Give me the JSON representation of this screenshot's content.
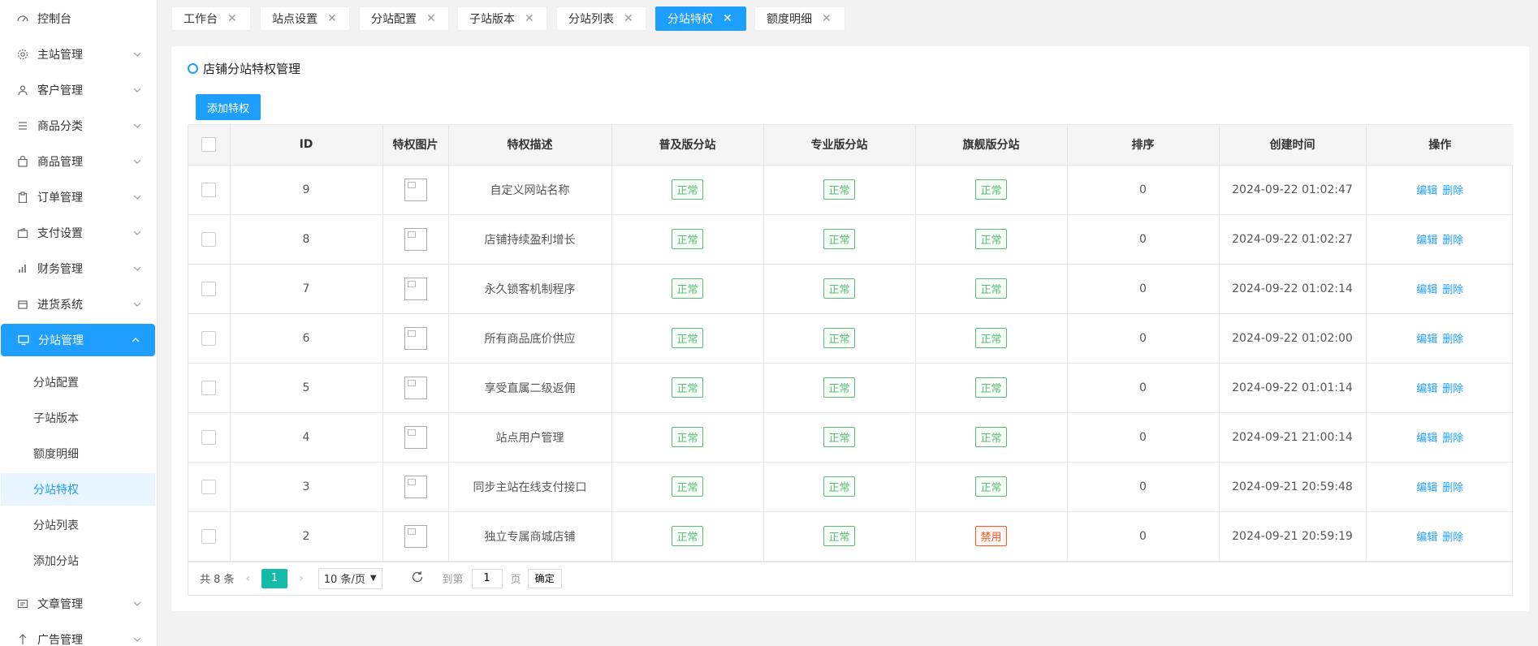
{
  "sidebar": {
    "items": [
      {
        "label": "控制台",
        "icon": "dashboard-icon",
        "has_arrow": false
      },
      {
        "label": "主站管理",
        "icon": "gear-icon",
        "has_arrow": true
      },
      {
        "label": "客户管理",
        "icon": "user-icon",
        "has_arrow": true
      },
      {
        "label": "商品分类",
        "icon": "list-icon",
        "has_arrow": true
      },
      {
        "label": "商品管理",
        "icon": "bag-icon",
        "has_arrow": true
      },
      {
        "label": "订单管理",
        "icon": "clipboard-icon",
        "has_arrow": true
      },
      {
        "label": "支付设置",
        "icon": "wallet-icon",
        "has_arrow": true
      },
      {
        "label": "财务管理",
        "icon": "bar-chart-icon",
        "has_arrow": true
      },
      {
        "label": "进货系统",
        "icon": "cart-icon",
        "has_arrow": true
      },
      {
        "label": "分站管理",
        "icon": "monitor-icon",
        "has_arrow": true,
        "active": true
      },
      {
        "label": "文章管理",
        "icon": "article-icon",
        "has_arrow": true
      },
      {
        "label": "广告管理",
        "icon": "ad-icon",
        "has_arrow": true
      }
    ],
    "subitems": [
      {
        "label": "分站配置"
      },
      {
        "label": "子站版本"
      },
      {
        "label": "额度明细"
      },
      {
        "label": "分站特权",
        "active": true
      },
      {
        "label": "分站列表"
      },
      {
        "label": "添加分站"
      }
    ]
  },
  "tabs": [
    {
      "label": "工作台"
    },
    {
      "label": "站点设置"
    },
    {
      "label": "分站配置"
    },
    {
      "label": "子站版本"
    },
    {
      "label": "分站列表"
    },
    {
      "label": "分站特权",
      "active": true
    },
    {
      "label": "额度明细"
    }
  ],
  "card": {
    "title": "店铺分站特权管理",
    "add_button": "添加特权"
  },
  "table": {
    "headers": [
      "ID",
      "特权图片",
      "特权描述",
      "普及版分站",
      "专业版分站",
      "旗舰版分站",
      "排序",
      "创建时间",
      "操作"
    ],
    "rows": [
      {
        "id": "9",
        "desc": "自定义网站名称",
        "basic": "正常",
        "pro": "正常",
        "flagship": "正常",
        "sort": "0",
        "created": "2024-09-22 01:02:47"
      },
      {
        "id": "8",
        "desc": "店铺持续盈利增长",
        "basic": "正常",
        "pro": "正常",
        "flagship": "正常",
        "sort": "0",
        "created": "2024-09-22 01:02:27"
      },
      {
        "id": "7",
        "desc": "永久锁客机制程序",
        "basic": "正常",
        "pro": "正常",
        "flagship": "正常",
        "sort": "0",
        "created": "2024-09-22 01:02:14"
      },
      {
        "id": "6",
        "desc": "所有商品底价供应",
        "basic": "正常",
        "pro": "正常",
        "flagship": "正常",
        "sort": "0",
        "created": "2024-09-22 01:02:00"
      },
      {
        "id": "5",
        "desc": "享受直属二级返佣",
        "basic": "正常",
        "pro": "正常",
        "flagship": "正常",
        "sort": "0",
        "created": "2024-09-22 01:01:14"
      },
      {
        "id": "4",
        "desc": "站点用户管理",
        "basic": "正常",
        "pro": "正常",
        "flagship": "正常",
        "sort": "0",
        "created": "2024-09-21 21:00:14"
      },
      {
        "id": "3",
        "desc": "同步主站在线支付接口",
        "basic": "正常",
        "pro": "正常",
        "flagship": "正常",
        "sort": "0",
        "created": "2024-09-21 20:59:48"
      },
      {
        "id": "2",
        "desc": "独立专属商城店铺",
        "basic": "正常",
        "pro": "正常",
        "flagship": "禁用",
        "sort": "0",
        "created": "2024-09-21 20:59:19"
      }
    ],
    "edit_label": "编辑",
    "delete_label": "删除"
  },
  "pager": {
    "total": "共 8 条",
    "current_page": "1",
    "page_size": "10 条/页",
    "goto_label": "到第",
    "goto_value": "1",
    "page_unit": "页",
    "confirm": "确定"
  },
  "colors": {
    "accent": "#1e9fff",
    "ok": "#5fb878",
    "disabled": "#ff5722",
    "pager_active": "#16baaa"
  }
}
